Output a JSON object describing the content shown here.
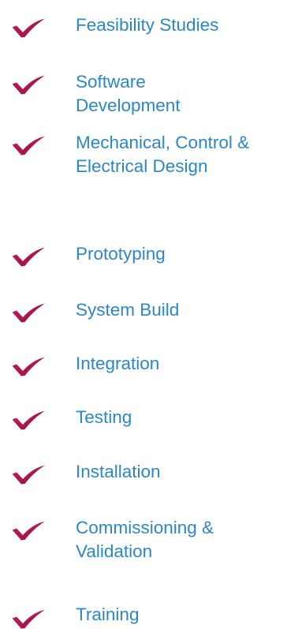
{
  "icon": {
    "name": "checkmark-icon",
    "color": "#a0174a",
    "accent_color": "#c81c62"
  },
  "link_color": "#2a87c8",
  "services": [
    {
      "label": "Feasibility Studies"
    },
    {
      "label": "Software Development"
    },
    {
      "label": "Mechanical, Control & Electrical Design"
    },
    {
      "label": "Prototyping"
    },
    {
      "label": "System Build"
    },
    {
      "label": "Integration"
    },
    {
      "label": "Testing"
    },
    {
      "label": "Installation"
    },
    {
      "label": "Commissioning & Validation"
    },
    {
      "label": "Training"
    }
  ]
}
